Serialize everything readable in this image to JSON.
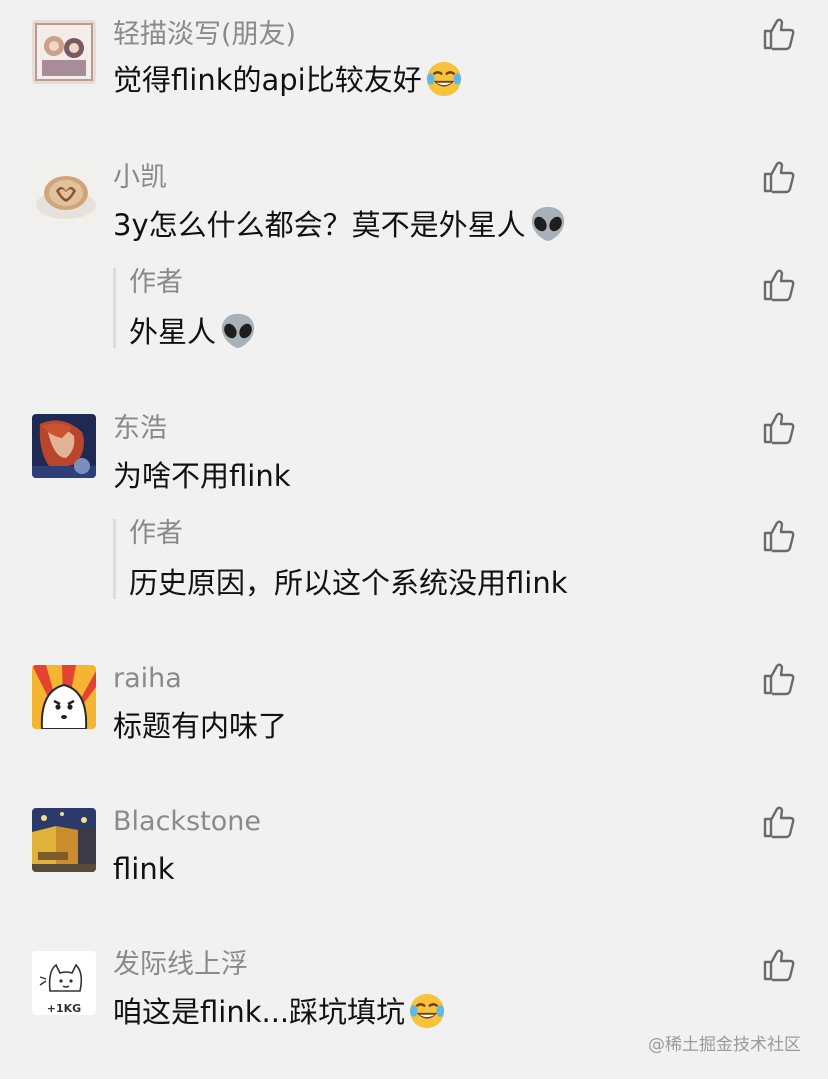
{
  "comments": [
    {
      "name": "轻描淡写(朋友)",
      "text": "觉得flink的api比较友好",
      "emoji": "face-laughing-tears"
    },
    {
      "name": "小凯",
      "text": "3y怎么什么都会？莫不是外星人",
      "emoji": "alien",
      "reply": {
        "name": "作者",
        "text": "外星人",
        "emoji": "alien"
      }
    },
    {
      "name": "东浩",
      "text": "为啥不用flink",
      "reply": {
        "name": "作者",
        "text": "历史原因，所以这个系统没用flink"
      }
    },
    {
      "name": "raiha",
      "text": "标题有内味了"
    },
    {
      "name": "Blackstone",
      "text": "flink"
    },
    {
      "name": "发际线上浮",
      "text": "咱这是flink...踩坑填坑",
      "emoji": "face-laughing-tears",
      "avatar_text": "+1KG"
    }
  ],
  "watermark": "@稀土掘金技术社区",
  "colors": {
    "background": "#f1f1f1",
    "name": "#8a8a8a",
    "text": "#111111"
  }
}
